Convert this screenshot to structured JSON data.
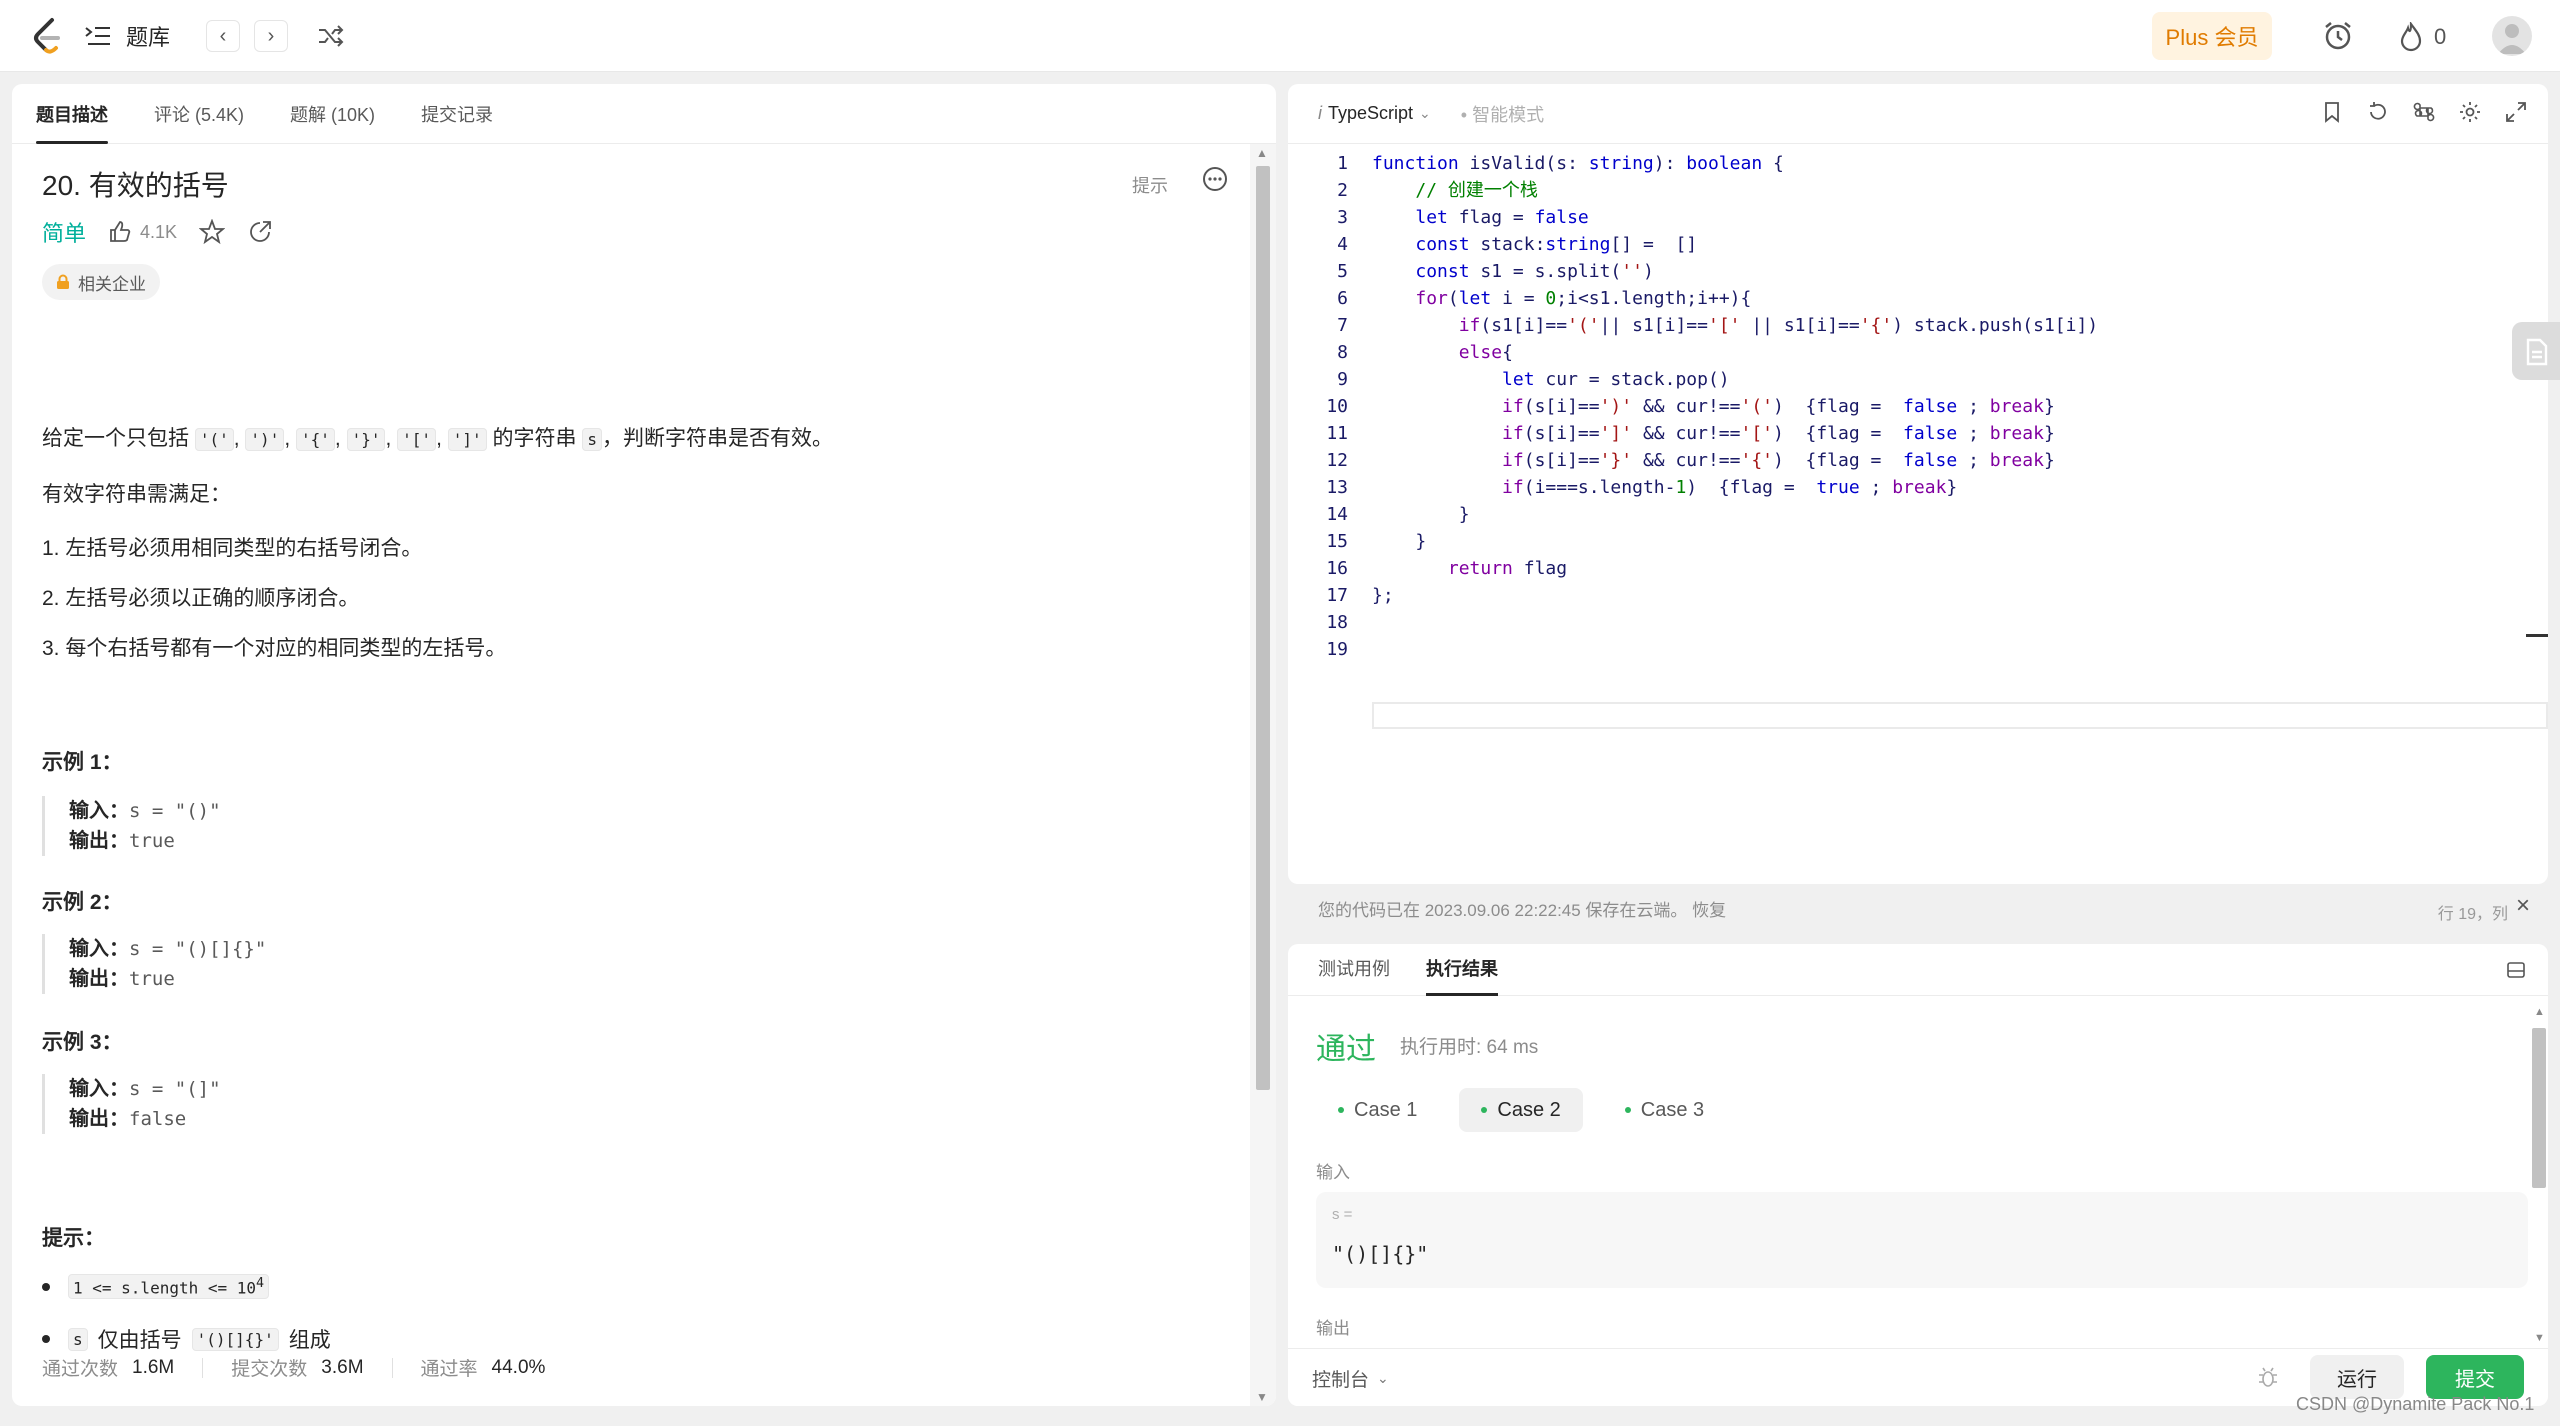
{
  "nav": {
    "problem_bank": "题库",
    "plus_label": "Plus 会员",
    "fire_count": "0"
  },
  "left": {
    "tabs": [
      "题目描述",
      "评论 (5.4K)",
      "题解 (10K)",
      "提交记录"
    ],
    "title": "20. 有效的括号",
    "hint": "提示",
    "difficulty": "简单",
    "likes": "4.1K",
    "company_tag": "相关企业",
    "desc_prefix": "给定一个只包括",
    "desc_chars": [
      "'('",
      "')'",
      "'{'",
      "'}'",
      "'['",
      "']'"
    ],
    "desc_mid": "的字符串",
    "desc_var": "s",
    "desc_suffix": "，判断字符串是否有效。",
    "valid_intro": "有效字符串需满足：",
    "rules": [
      "1. 左括号必须用相同类型的右括号闭合。",
      "2. 左括号必须以正确的顺序闭合。",
      "3. 每个右括号都有一个对应的相同类型的左括号。"
    ],
    "examples": [
      {
        "title": "示例 1：",
        "input_label": "输入：",
        "input": "s = \"()\"",
        "output_label": "输出：",
        "output": "true"
      },
      {
        "title": "示例 2：",
        "input_label": "输入：",
        "input": "s = \"()[]{}\"",
        "output_label": "输出：",
        "output": "true"
      },
      {
        "title": "示例 3：",
        "input_label": "输入：",
        "input": "s = \"(]\"",
        "output_label": "输出：",
        "output": "false"
      }
    ],
    "tips_title": "提示：",
    "tip1_code": "1 <= s.length <= 10",
    "tip1_sup": "4",
    "tip2_var": "s",
    "tip2_mid": "仅由括号",
    "tip2_code": "'()[]{}'",
    "tip2_end": "组成",
    "stats": [
      {
        "label": "通过次数",
        "value": "1.6M"
      },
      {
        "label": "提交次数",
        "value": "3.6M"
      },
      {
        "label": "通过率",
        "value": "44.0%"
      }
    ]
  },
  "editor": {
    "language": "TypeScript",
    "ai_mode": "智能模式",
    "lines": [
      "function isValid(s: string): boolean {",
      "    // 创建一个栈",
      "    let flag = false",
      "    const stack:string[] =  []",
      "    const s1 = s.split('')",
      "    for(let i = 0;i<s1.length;i++){",
      "        if(s1[i]=='('|| s1[i]=='[' || s1[i]=='{') stack.push(s1[i])",
      "        else{",
      "            let cur = stack.pop()",
      "            if(s[i]==')' && cur!=='(')  {flag =  false ; break}",
      "            if(s[i]==']' && cur!=='[')  {flag =  false ; break}",
      "            if(s[i]=='}' && cur!=='{')  {flag =  false ; break}",
      "            if(i===s.length-1)  {flag =  true ; break}",
      "        }",
      "    }",
      "       return flag",
      "};",
      "",
      ""
    ],
    "save_status": "您的代码已在 2023.09.06 22:22:45 保存在云端。 恢复",
    "cursor_pos": "行 19，列"
  },
  "result": {
    "tabs": [
      "测试用例",
      "执行结果"
    ],
    "status": "通过",
    "runtime": "执行用时: 64 ms",
    "cases": [
      "Case 1",
      "Case 2",
      "Case 3"
    ],
    "input_label": "输入",
    "input_var": "s =",
    "input_value": "\"()[]{}\"",
    "output_label": "输出"
  },
  "footer": {
    "console": "控制台",
    "run": "运行",
    "submit": "提交"
  },
  "watermark": "CSDN @Dynamite Pack No.1",
  "colors": {
    "accent_green": "#2db55d",
    "difficulty_teal": "#00af9b",
    "plus_orange": "#e07b00"
  }
}
